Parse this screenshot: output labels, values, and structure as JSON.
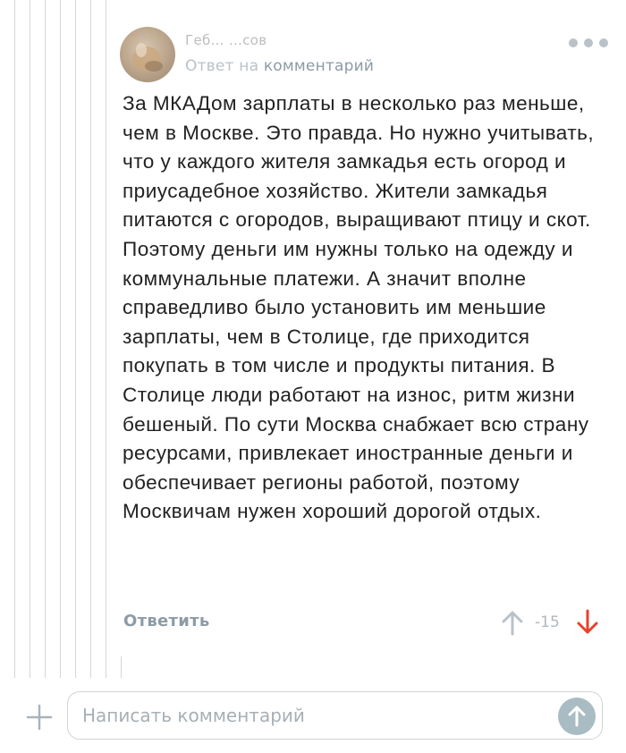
{
  "comment": {
    "author_name": "Геб… …сов",
    "reply_prefix": "Ответ на",
    "reply_link": "комментарий",
    "text": "За МКАДом зарплаты в несколько раз меньше, чем в Москве. Это правда. Но нужно учитывать, что у каждого жителя замкадья есть огород и приусадебное хозяйство. Жители замкадья питаются с огородов, выращивают птицу и скот. Поэтому деньги им нужны только на одежду и коммунальные платежи. А значит вполне справедливо было установить им меньшие зарплаты, чем в Столице, где приходится покупать в том числе и продукты питания. В Столице люди работают на износ, ритм жизни бешеный. По сути Москва снабжает всю страну ресурсами, привлекает иностранные деньги и обеспечивает регионы работой, поэтому Москвичам нужен хороший дорогой отдых.",
    "reply_label": "Ответить",
    "rating": "-15",
    "icons": {
      "avatar": "avatar",
      "more": "more-icon",
      "vote_up": "arrow-up-icon",
      "vote_down": "arrow-down-icon"
    }
  },
  "composer": {
    "placeholder": "Написать комментарий",
    "value": "",
    "icons": {
      "add": "plus-icon",
      "send": "send-arrow-icon"
    }
  },
  "colors": {
    "accent": "#8c9ba6",
    "downvote": "#e8412c",
    "upvote": "#b9c2c9",
    "send_button": "#a9bcc4"
  }
}
